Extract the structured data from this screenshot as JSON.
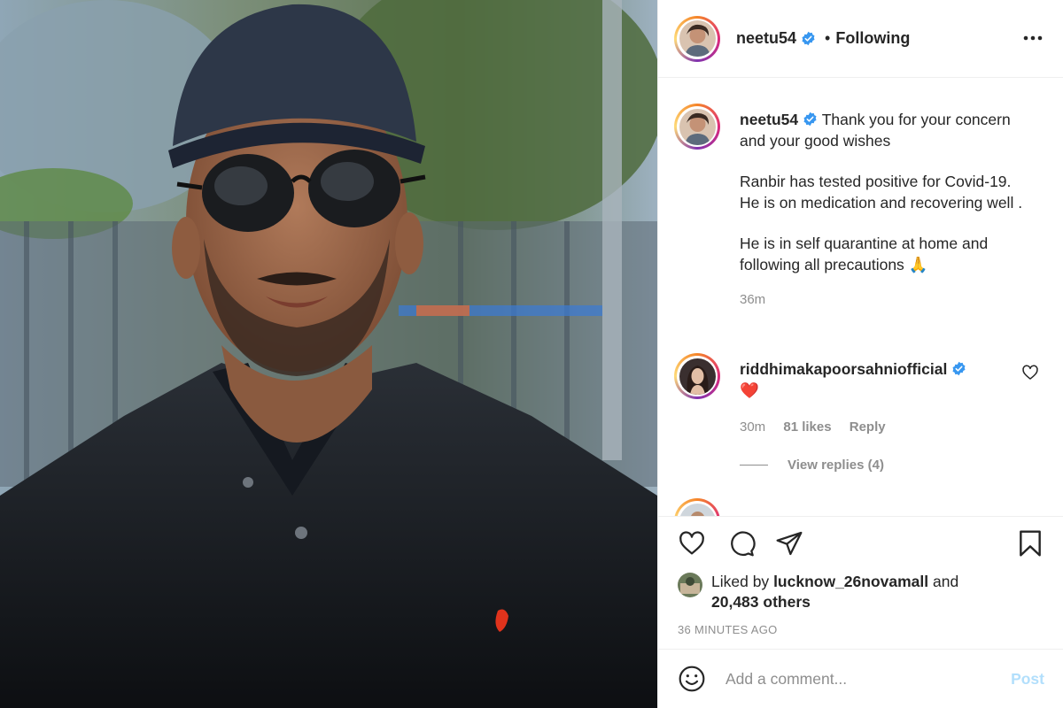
{
  "post": {
    "author": "neetu54",
    "separator": "•",
    "follow_state": "Following",
    "more_icon": "more-horizontal-icon"
  },
  "caption": {
    "username": "neetu54",
    "line1": "Thank you for your concern and your good wishes",
    "para2": "Ranbir has tested positive for Covid-19. He is on medication and recovering well .",
    "para3": "He is in self quarantine at home and following all precautions 🙏",
    "time": "36m"
  },
  "comments": [
    {
      "username": "riddhimakapoorsahniofficial",
      "text": "❤️",
      "time": "30m",
      "likes": "81 likes",
      "reply_label": "Reply",
      "view_replies": "View replies (4)"
    }
  ],
  "actions": {
    "like_icon": "heart-icon",
    "comment_icon": "comment-icon",
    "share_icon": "paper-plane-icon",
    "save_icon": "bookmark-icon"
  },
  "likes": {
    "prefix": "Liked by",
    "user": "lucknow_26novamall",
    "and": "and",
    "others": "20,483 others"
  },
  "posted": "36 MINUTES AGO",
  "composer": {
    "emoji_icon": "smiley-icon",
    "placeholder": "Add a comment...",
    "post_label": "Post"
  },
  "colors": {
    "verified": "#3897f0",
    "post_disabled": "#b2dffc",
    "secondary_text": "#8e8e8e",
    "heart_red": "#ed4956"
  }
}
